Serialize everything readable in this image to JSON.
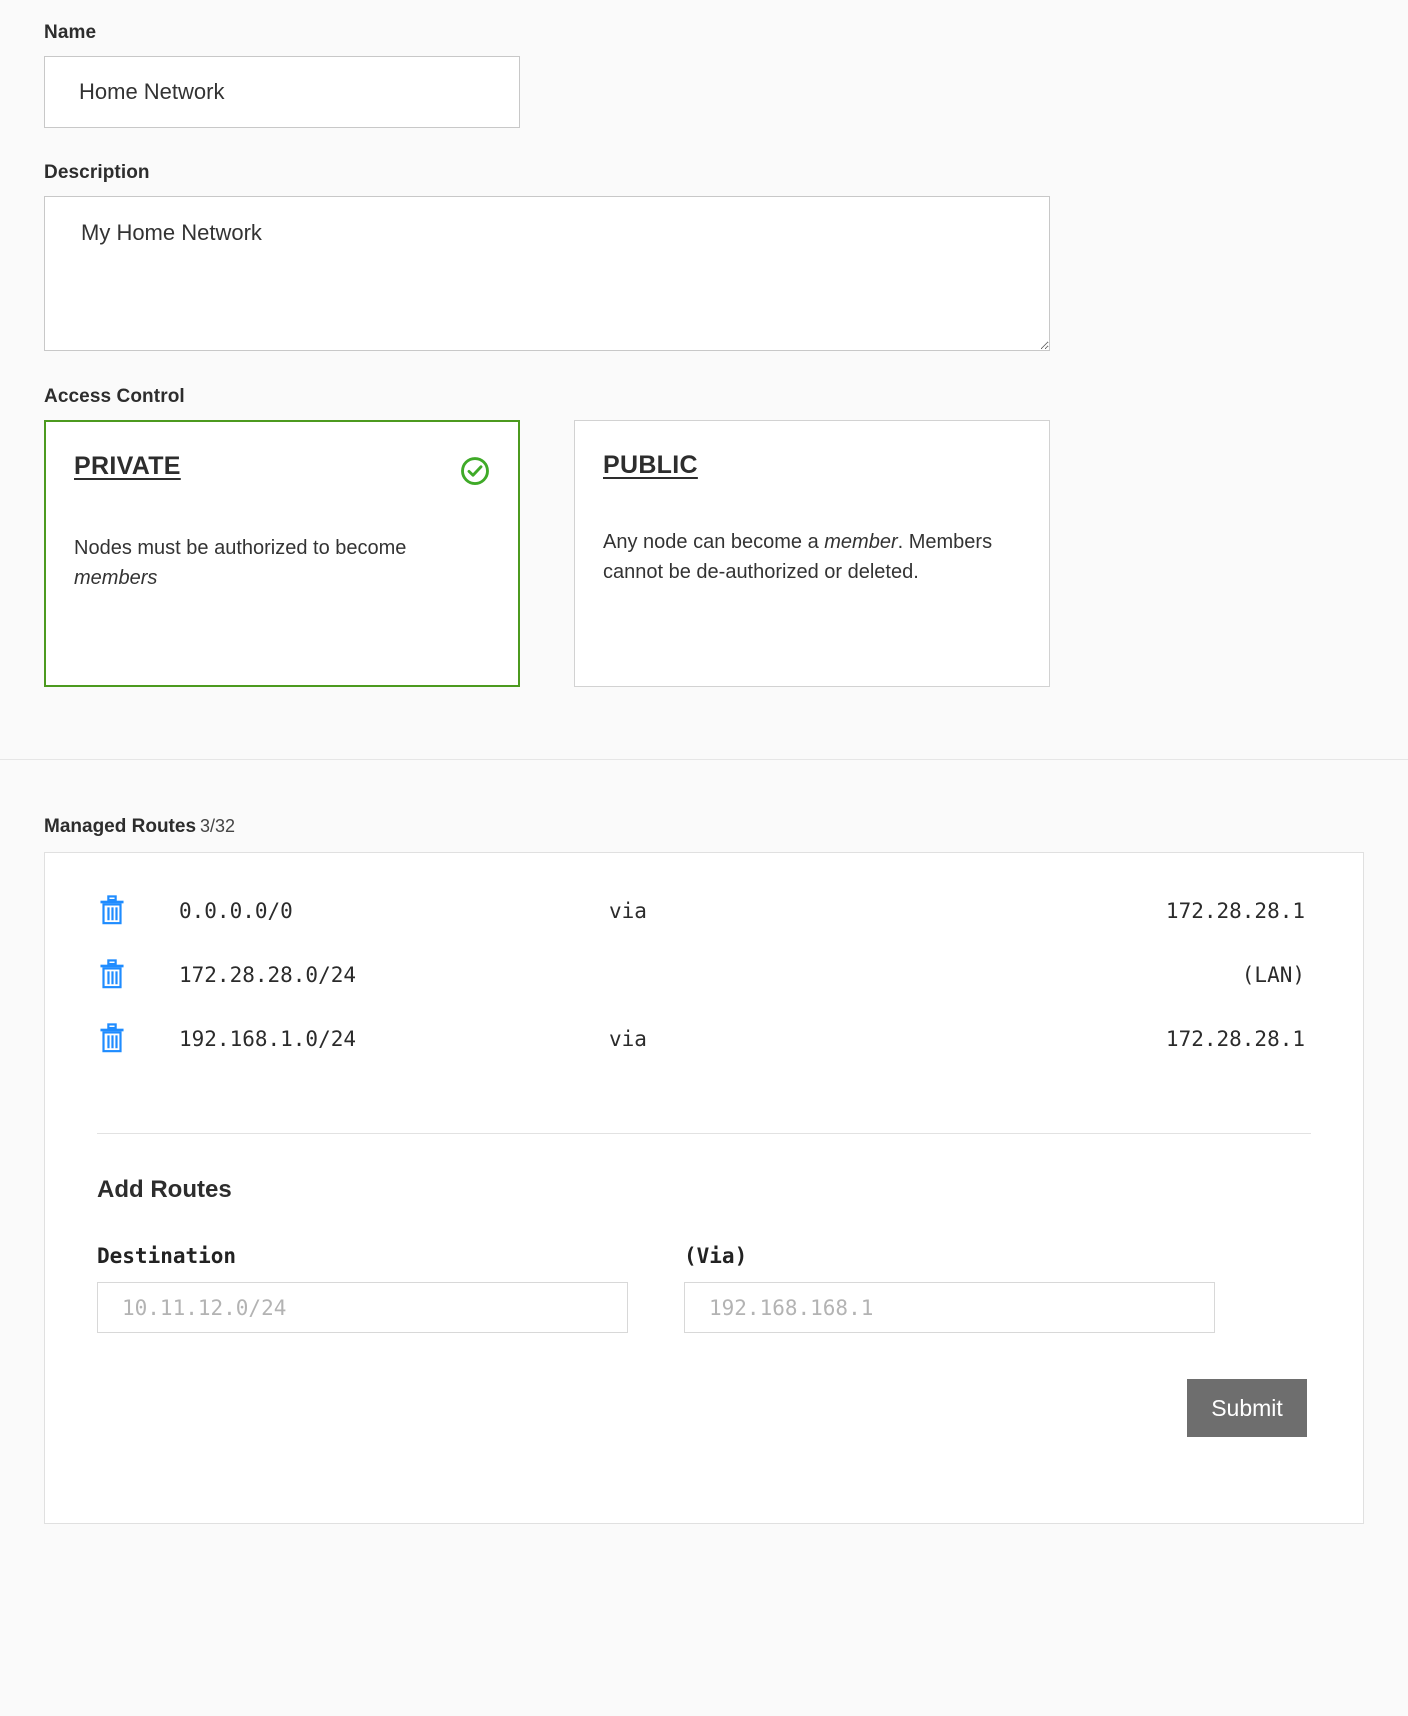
{
  "form": {
    "name": {
      "label": "Name",
      "value": "Home Network"
    },
    "description": {
      "label": "Description",
      "value": "My Home Network"
    },
    "access_control": {
      "label": "Access Control",
      "selected": "PRIVATE",
      "options": [
        {
          "title": "PRIVATE",
          "description_before": "Nodes must be authorized to become ",
          "description_em": "members",
          "description_after": "",
          "selected": true,
          "check_icon": "check-circle-icon"
        },
        {
          "title": "PUBLIC",
          "description_before": "Any node can become a ",
          "description_em": "member",
          "description_after": ". Members cannot be de-authorized or deleted.",
          "selected": false,
          "check_icon": ""
        }
      ]
    }
  },
  "managed_routes": {
    "title": "Managed Routes",
    "count": "3/32",
    "delete_icon": "trash-icon",
    "rows": [
      {
        "destination": "0.0.0.0/0",
        "via": "via",
        "gateway": "172.28.28.1"
      },
      {
        "destination": "172.28.28.0/24",
        "via": "",
        "gateway": "(LAN)"
      },
      {
        "destination": "192.168.1.0/24",
        "via": "via",
        "gateway": "172.28.28.1"
      }
    ],
    "add_routes": {
      "title": "Add Routes",
      "destination": {
        "label": "Destination",
        "value": "",
        "placeholder": "10.11.12.0/24"
      },
      "via": {
        "label": "(Via)",
        "value": "",
        "placeholder": "192.168.168.1"
      },
      "submit_label": "Submit"
    }
  },
  "colors": {
    "selected_border": "#4c9a1f",
    "check_green": "#3faa28",
    "trash_blue": "#1f8cff",
    "submit_bg": "#6e6e6e",
    "page_bg": "#fafafa"
  }
}
